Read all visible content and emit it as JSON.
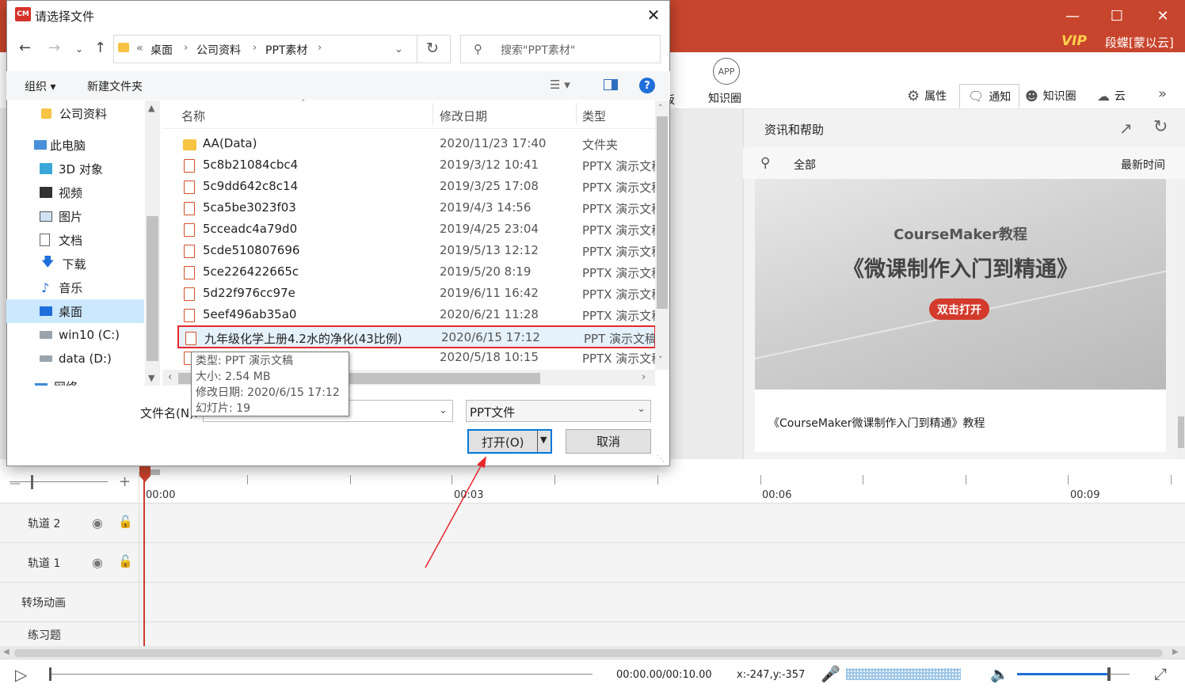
{
  "app": {
    "user": "段蝶[蒙以云]",
    "vip": "VIP",
    "toolbar": {
      "app_label": "知识圈",
      "app_icon_text": "APP",
      "partial_label": "板"
    },
    "right_tabs": [
      {
        "label": "属性",
        "icon": "gear-icon"
      },
      {
        "label": "通知",
        "icon": "chat-icon"
      },
      {
        "label": "知识圈",
        "icon": "people-icon"
      },
      {
        "label": "云",
        "icon": "cloud-icon"
      }
    ],
    "panel": {
      "title": "资讯和帮助",
      "filter": "全部",
      "sort": "最新时间",
      "news": {
        "thumb_title1": "CourseMaker教程",
        "thumb_title2": "《微课制作入门到精通》",
        "thumb_button": "双击打开",
        "caption": "《CourseMaker微课制作入门到精通》教程"
      }
    },
    "timeline": {
      "ticks": [
        "00:00",
        "00:03",
        "00:06",
        "00:09"
      ],
      "tracks": [
        "轨道 2",
        "轨道 1",
        "转场动画",
        "练习题"
      ]
    },
    "player": {
      "time": "00:00.00/00:10.00",
      "coords": "x:-247,y:-357",
      "volume_level": 0.82
    }
  },
  "dialog": {
    "logo": "CM",
    "title": "请选择文件",
    "breadcrumb": {
      "prefix": "«",
      "items": [
        "桌面",
        "公司资料",
        "PPT素材"
      ]
    },
    "search_placeholder": "搜索\"PPT素材\"",
    "commands": {
      "organize": "组织 ▾",
      "new_folder": "新建文件夹"
    },
    "nav": [
      {
        "label": "公司资料",
        "icon": "folder-icon"
      },
      {
        "label": "此电脑",
        "icon": "computer-icon"
      },
      {
        "label": "3D 对象",
        "icon": "cube-icon"
      },
      {
        "label": "视频",
        "icon": "video-icon"
      },
      {
        "label": "图片",
        "icon": "picture-icon"
      },
      {
        "label": "文档",
        "icon": "document-icon"
      },
      {
        "label": "下载",
        "icon": "download-icon"
      },
      {
        "label": "音乐",
        "icon": "music-icon"
      },
      {
        "label": "桌面",
        "icon": "desktop-icon"
      },
      {
        "label": "win10 (C:)",
        "icon": "drive-icon"
      },
      {
        "label": "data (D:)",
        "icon": "drive-icon"
      },
      {
        "label": "网络",
        "icon": "network-icon"
      }
    ],
    "columns": {
      "name": "名称",
      "date": "修改日期",
      "type": "类型"
    },
    "files": [
      {
        "name": "AA(Data)",
        "date": "2020/11/23 17:40",
        "type": "文件夹"
      },
      {
        "name": "5c8b21084cbc4",
        "date": "2019/3/12 10:41",
        "type": "PPTX 演示文稿"
      },
      {
        "name": "5c9dd642c8c14",
        "date": "2019/3/25 17:08",
        "type": "PPTX 演示文稿"
      },
      {
        "name": "5ca5be3023f03",
        "date": "2019/4/3 14:56",
        "type": "PPTX 演示文稿"
      },
      {
        "name": "5cceadc4a79d0",
        "date": "2019/4/25 23:04",
        "type": "PPTX 演示文稿"
      },
      {
        "name": "5cde510807696",
        "date": "2019/5/13 12:12",
        "type": "PPTX 演示文稿"
      },
      {
        "name": "5ce226422665c",
        "date": "2019/5/20 8:19",
        "type": "PPTX 演示文稿"
      },
      {
        "name": "5d22f976cc97e",
        "date": "2019/6/11 16:42",
        "type": "PPTX 演示文稿"
      },
      {
        "name": "5eef496ab35a0",
        "date": "2020/6/21 11:28",
        "type": "PPTX 演示文稿"
      },
      {
        "name": "九年级化学上册4.2水的净化(43比例)",
        "date": "2020/6/15 17:12",
        "type": "PPT 演示文稿"
      },
      {
        "name": "",
        "date": "2020/5/18 10:15",
        "type": "PPTX 演示文稿"
      }
    ],
    "tooltip": {
      "type": "类型: PPT 演示文稿",
      "size": "大小: 2.54 MB",
      "date": "修改日期: 2020/6/15 17:12",
      "slides": "幻灯片: 19"
    },
    "filename_label": "文件名(N):",
    "filename_value": "",
    "filetype": "PPT文件",
    "open_label": "打开(O)",
    "cancel_label": "取消"
  }
}
